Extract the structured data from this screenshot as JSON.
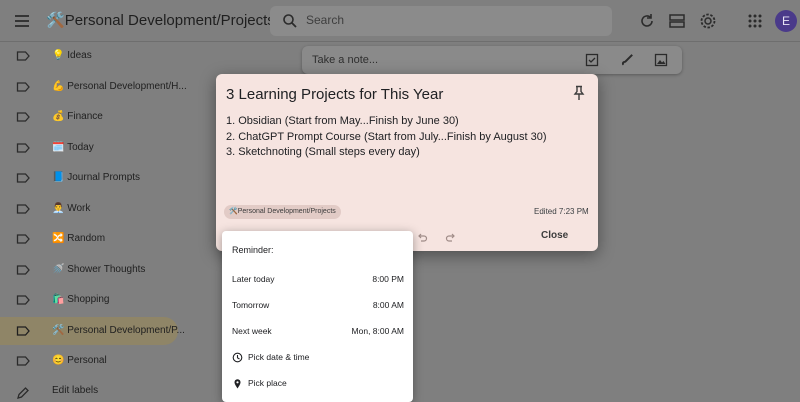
{
  "header": {
    "title": "Personal Development/Projects",
    "search_placeholder": "Search",
    "avatar_initial": "E"
  },
  "sidebar": {
    "items": [
      {
        "label": "Ideas",
        "emoji": "💡"
      },
      {
        "label": "Personal Development/H...",
        "emoji": "💪"
      },
      {
        "label": "Finance",
        "emoji": "💰"
      },
      {
        "label": "Today",
        "emoji": "🗓️"
      },
      {
        "label": "Journal Prompts",
        "emoji": "📘"
      },
      {
        "label": "Work",
        "emoji": "👨‍💼"
      },
      {
        "label": "Random",
        "emoji": "🔀"
      },
      {
        "label": "Shower Thoughts",
        "emoji": "🚿"
      },
      {
        "label": "Shopping",
        "emoji": "🛍️"
      },
      {
        "label": "Personal Development/P...",
        "emoji": "🛠️"
      },
      {
        "label": "Personal",
        "emoji": "😊"
      }
    ],
    "active_index": 9,
    "edit_labels": "Edit labels"
  },
  "note_bar": {
    "placeholder": "Take a note..."
  },
  "note": {
    "title": "3 Learning Projects for This Year",
    "lines": [
      "1. Obsidian (Start from May...Finish by June 30)",
      "2. ChatGPT Prompt Course (Start from July...Finish by August 30)",
      "3. Sketchnoting (Small steps every day)"
    ],
    "label_chip": "Personal Development/Projects",
    "edited": "Edited 7:23 PM",
    "close_label": "Close",
    "background_color": "#f6e4e0"
  },
  "reminder": {
    "header": "Reminder:",
    "options": [
      {
        "label": "Later today",
        "time": "8:00 PM"
      },
      {
        "label": "Tomorrow",
        "time": "8:00 AM"
      },
      {
        "label": "Next week",
        "time": "Mon, 8:00 AM"
      }
    ],
    "pick_date_time": "Pick date & time",
    "pick_place": "Pick place"
  },
  "colors": {
    "overlay": "#7f7f7f",
    "active_label_bg": "#8f8567",
    "avatar": "#4a3a8a"
  }
}
